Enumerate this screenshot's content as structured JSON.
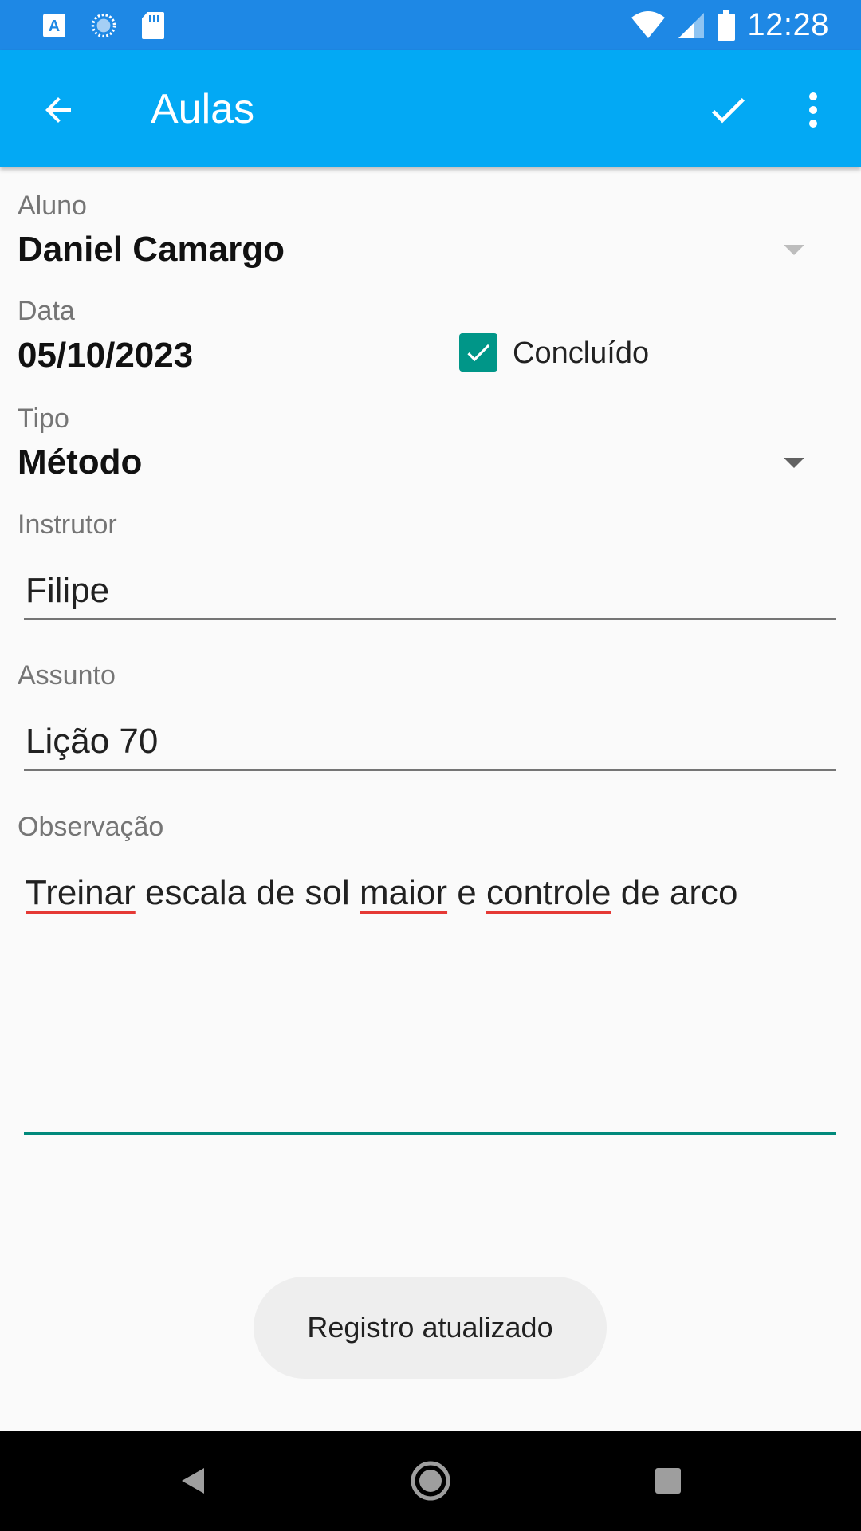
{
  "status_bar": {
    "time": "12:28",
    "left_icons": [
      "text-a-icon",
      "loading-circle-icon",
      "sd-card-icon"
    ],
    "right_icons": [
      "wifi-icon",
      "cell-signal-icon",
      "battery-icon"
    ]
  },
  "app_bar": {
    "title": "Aulas",
    "back_icon": "arrow-back-icon",
    "save_icon": "check-icon",
    "menu_icon": "more-vert-icon"
  },
  "form": {
    "aluno": {
      "label": "Aluno",
      "value": "Daniel Camargo"
    },
    "data": {
      "label": "Data",
      "value": "05/10/2023"
    },
    "concluido": {
      "label": "Concluído",
      "checked": true
    },
    "tipo": {
      "label": "Tipo",
      "value": "Método"
    },
    "instrutor": {
      "label": "Instrutor",
      "value": "Filipe"
    },
    "assunto": {
      "label": "Assunto",
      "value": "Lição 70"
    },
    "observacao": {
      "label": "Observação",
      "words": [
        "Treinar",
        " escala de sol ",
        "maior",
        " e ",
        "controle",
        " de arco"
      ]
    }
  },
  "toast": {
    "text": "Registro atualizado"
  },
  "nav_bar": {
    "icons": [
      "back-triangle-icon",
      "home-circle-icon",
      "recents-square-icon"
    ]
  },
  "colors": {
    "status_bar": "#1e88e5",
    "app_bar": "#03a9f4",
    "accent": "#009688",
    "spell_error": "#e53935"
  }
}
